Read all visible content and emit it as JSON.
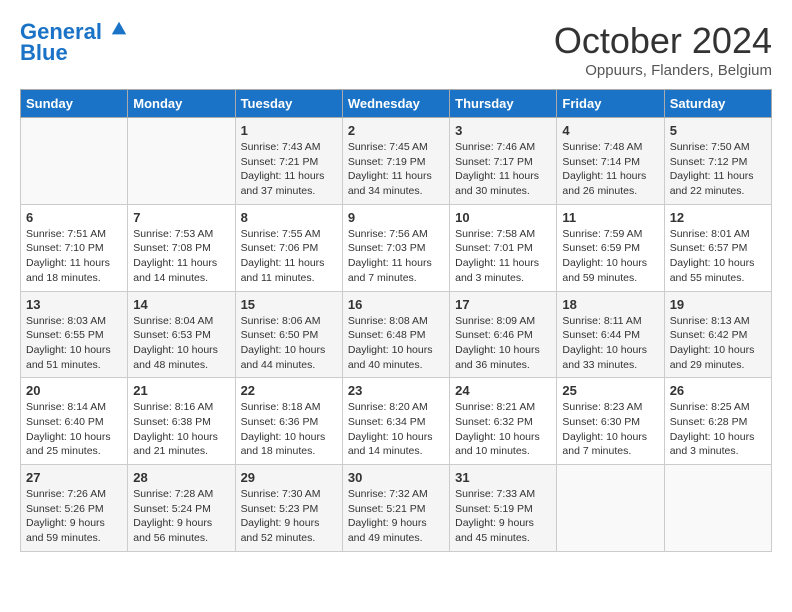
{
  "header": {
    "logo_line1": "General",
    "logo_line2": "Blue",
    "month": "October 2024",
    "location": "Oppuurs, Flanders, Belgium"
  },
  "weekdays": [
    "Sunday",
    "Monday",
    "Tuesday",
    "Wednesday",
    "Thursday",
    "Friday",
    "Saturday"
  ],
  "weeks": [
    [
      {
        "day": "",
        "info": ""
      },
      {
        "day": "",
        "info": ""
      },
      {
        "day": "1",
        "info": "Sunrise: 7:43 AM\nSunset: 7:21 PM\nDaylight: 11 hours and 37 minutes."
      },
      {
        "day": "2",
        "info": "Sunrise: 7:45 AM\nSunset: 7:19 PM\nDaylight: 11 hours and 34 minutes."
      },
      {
        "day": "3",
        "info": "Sunrise: 7:46 AM\nSunset: 7:17 PM\nDaylight: 11 hours and 30 minutes."
      },
      {
        "day": "4",
        "info": "Sunrise: 7:48 AM\nSunset: 7:14 PM\nDaylight: 11 hours and 26 minutes."
      },
      {
        "day": "5",
        "info": "Sunrise: 7:50 AM\nSunset: 7:12 PM\nDaylight: 11 hours and 22 minutes."
      }
    ],
    [
      {
        "day": "6",
        "info": "Sunrise: 7:51 AM\nSunset: 7:10 PM\nDaylight: 11 hours and 18 minutes."
      },
      {
        "day": "7",
        "info": "Sunrise: 7:53 AM\nSunset: 7:08 PM\nDaylight: 11 hours and 14 minutes."
      },
      {
        "day": "8",
        "info": "Sunrise: 7:55 AM\nSunset: 7:06 PM\nDaylight: 11 hours and 11 minutes."
      },
      {
        "day": "9",
        "info": "Sunrise: 7:56 AM\nSunset: 7:03 PM\nDaylight: 11 hours and 7 minutes."
      },
      {
        "day": "10",
        "info": "Sunrise: 7:58 AM\nSunset: 7:01 PM\nDaylight: 11 hours and 3 minutes."
      },
      {
        "day": "11",
        "info": "Sunrise: 7:59 AM\nSunset: 6:59 PM\nDaylight: 10 hours and 59 minutes."
      },
      {
        "day": "12",
        "info": "Sunrise: 8:01 AM\nSunset: 6:57 PM\nDaylight: 10 hours and 55 minutes."
      }
    ],
    [
      {
        "day": "13",
        "info": "Sunrise: 8:03 AM\nSunset: 6:55 PM\nDaylight: 10 hours and 51 minutes."
      },
      {
        "day": "14",
        "info": "Sunrise: 8:04 AM\nSunset: 6:53 PM\nDaylight: 10 hours and 48 minutes."
      },
      {
        "day": "15",
        "info": "Sunrise: 8:06 AM\nSunset: 6:50 PM\nDaylight: 10 hours and 44 minutes."
      },
      {
        "day": "16",
        "info": "Sunrise: 8:08 AM\nSunset: 6:48 PM\nDaylight: 10 hours and 40 minutes."
      },
      {
        "day": "17",
        "info": "Sunrise: 8:09 AM\nSunset: 6:46 PM\nDaylight: 10 hours and 36 minutes."
      },
      {
        "day": "18",
        "info": "Sunrise: 8:11 AM\nSunset: 6:44 PM\nDaylight: 10 hours and 33 minutes."
      },
      {
        "day": "19",
        "info": "Sunrise: 8:13 AM\nSunset: 6:42 PM\nDaylight: 10 hours and 29 minutes."
      }
    ],
    [
      {
        "day": "20",
        "info": "Sunrise: 8:14 AM\nSunset: 6:40 PM\nDaylight: 10 hours and 25 minutes."
      },
      {
        "day": "21",
        "info": "Sunrise: 8:16 AM\nSunset: 6:38 PM\nDaylight: 10 hours and 21 minutes."
      },
      {
        "day": "22",
        "info": "Sunrise: 8:18 AM\nSunset: 6:36 PM\nDaylight: 10 hours and 18 minutes."
      },
      {
        "day": "23",
        "info": "Sunrise: 8:20 AM\nSunset: 6:34 PM\nDaylight: 10 hours and 14 minutes."
      },
      {
        "day": "24",
        "info": "Sunrise: 8:21 AM\nSunset: 6:32 PM\nDaylight: 10 hours and 10 minutes."
      },
      {
        "day": "25",
        "info": "Sunrise: 8:23 AM\nSunset: 6:30 PM\nDaylight: 10 hours and 7 minutes."
      },
      {
        "day": "26",
        "info": "Sunrise: 8:25 AM\nSunset: 6:28 PM\nDaylight: 10 hours and 3 minutes."
      }
    ],
    [
      {
        "day": "27",
        "info": "Sunrise: 7:26 AM\nSunset: 5:26 PM\nDaylight: 9 hours and 59 minutes."
      },
      {
        "day": "28",
        "info": "Sunrise: 7:28 AM\nSunset: 5:24 PM\nDaylight: 9 hours and 56 minutes."
      },
      {
        "day": "29",
        "info": "Sunrise: 7:30 AM\nSunset: 5:23 PM\nDaylight: 9 hours and 52 minutes."
      },
      {
        "day": "30",
        "info": "Sunrise: 7:32 AM\nSunset: 5:21 PM\nDaylight: 9 hours and 49 minutes."
      },
      {
        "day": "31",
        "info": "Sunrise: 7:33 AM\nSunset: 5:19 PM\nDaylight: 9 hours and 45 minutes."
      },
      {
        "day": "",
        "info": ""
      },
      {
        "day": "",
        "info": ""
      }
    ]
  ]
}
